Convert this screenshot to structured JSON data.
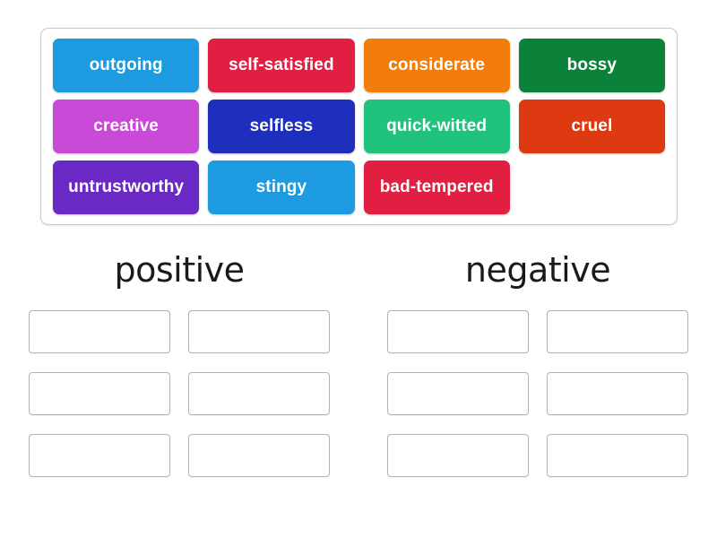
{
  "activity": {
    "type": "group-sort",
    "word_bank": {
      "rows": [
        [
          {
            "label": "outgoing",
            "color": "#1e9ae0"
          },
          {
            "label": "self-satisfied",
            "color": "#e01f42"
          },
          {
            "label": "considerate",
            "color": "#f37d0a"
          },
          {
            "label": "bossy",
            "color": "#0b8139"
          }
        ],
        [
          {
            "label": "creative",
            "color": "#c94ad6"
          },
          {
            "label": "selfless",
            "color": "#1f2fbd"
          },
          {
            "label": "quick-witted",
            "color": "#20c27c"
          },
          {
            "label": "cruel",
            "color": "#dd3a12"
          }
        ],
        [
          {
            "label": "untrustworthy",
            "color": "#6a29c4"
          },
          {
            "label": "stingy",
            "color": "#1e9ae0"
          },
          {
            "label": "bad-tempered",
            "color": "#e01f42"
          },
          {
            "label": "",
            "color": "transparent"
          }
        ]
      ]
    },
    "categories": [
      {
        "title": "positive",
        "dropzones": [
          "",
          "",
          "",
          "",
          "",
          ""
        ]
      },
      {
        "title": "negative",
        "dropzones": [
          "",
          "",
          "",
          "",
          "",
          ""
        ]
      }
    ]
  }
}
